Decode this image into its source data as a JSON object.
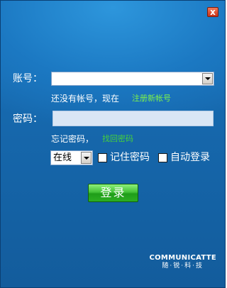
{
  "window": {
    "close_label": "x"
  },
  "account": {
    "label": "账号：",
    "value": ""
  },
  "register": {
    "prompt": "还没有帐号，现在",
    "link": "注册新帐号"
  },
  "password": {
    "label": "密码：",
    "value": ""
  },
  "recover": {
    "prompt": "忘记密码，",
    "link": "找回密码"
  },
  "status": {
    "selected": "在线"
  },
  "options": {
    "remember": "记住密码",
    "auto_login": "自动登录",
    "remember_checked": false,
    "auto_login_checked": false
  },
  "login": {
    "label": "登录"
  },
  "logo": {
    "brand": "COMMUNICATTE",
    "sub": "随·锐·科·技"
  },
  "colors": {
    "window_bg": "#1668ad",
    "link_green": "#7ef24a",
    "button_green": "#2cae22"
  }
}
